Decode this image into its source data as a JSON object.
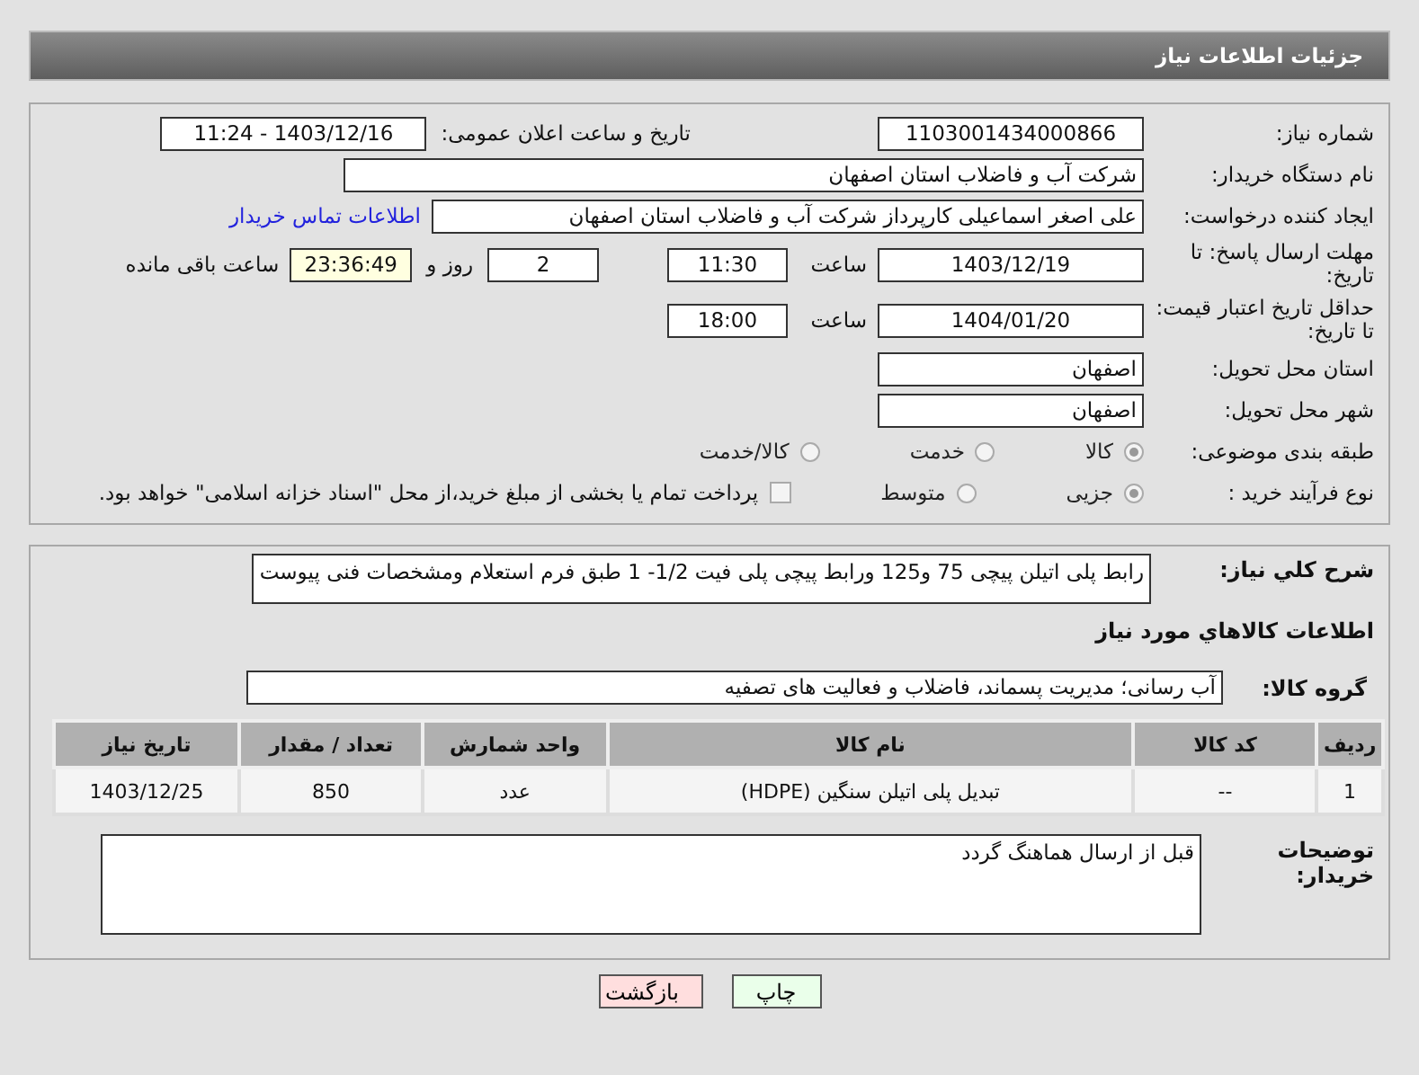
{
  "page_title": "جزئیات اطلاعات نیاز",
  "need_number": {
    "label": "شماره نیاز:",
    "value": "1103001434000866"
  },
  "announce": {
    "label": "تاریخ و ساعت اعلان عمومی:",
    "value": "1403/12/16 - 11:24"
  },
  "buyer_org": {
    "label": "نام دستگاه خریدار:",
    "value": "شرکت آب و فاضلاب استان اصفهان"
  },
  "requester": {
    "label": "ایجاد کننده درخواست:",
    "value": "علی اصغر اسماعیلی کارپرداز شرکت آب و فاضلاب استان اصفهان",
    "link": "اطلاعات تماس خریدار"
  },
  "deadline": {
    "label": "مهلت ارسال پاسخ: تا تاریخ:",
    "date": "1403/12/19",
    "time_label": "ساعت",
    "time": "11:30",
    "days": "2",
    "days_label": "روز و",
    "remaining": "23:36:49",
    "remaining_label": "ساعت باقی مانده"
  },
  "validity": {
    "label": "حداقل تاریخ اعتبار قیمت: تا تاریخ:",
    "date": "1404/01/20",
    "time_label": "ساعت",
    "time": "18:00"
  },
  "province": {
    "label": "استان محل تحویل:",
    "value": "اصفهان"
  },
  "city": {
    "label": "شهر محل تحویل:",
    "value": "اصفهان"
  },
  "category": {
    "label": "طبقه بندی موضوعی:",
    "options": [
      {
        "label": "کالا",
        "selected": true
      },
      {
        "label": "خدمت",
        "selected": false
      },
      {
        "label": "کالا/خدمت",
        "selected": false
      }
    ]
  },
  "process": {
    "label": "نوع فرآیند خرید :",
    "options": [
      {
        "label": "جزیی",
        "selected": true
      },
      {
        "label": "متوسط",
        "selected": false
      }
    ],
    "payment": {
      "checked": false,
      "text": "پرداخت تمام یا بخشی از مبلغ خرید،از محل \"اسناد خزانه اسلامی\" خواهد بود."
    }
  },
  "description": {
    "label": "شرح کلي نياز:",
    "value": "رابط پلی اتیلن پیچی 75 و125 ورابط پیچی پلی فیت 1/2- 1 طبق فرم استعلام ومشخصات فنی پیوست"
  },
  "goods_heading": "اطلاعات کالاهاي مورد نياز",
  "goods_group": {
    "label": "گروه کالا:",
    "value": "آب رسانی؛ مدیریت پسماند، فاضلاب و فعالیت های تصفیه"
  },
  "table": {
    "columns": [
      "ردیف",
      "کد کالا",
      "نام کالا",
      "واحد شمارش",
      "تعداد / مقدار",
      "تاریخ نیاز"
    ],
    "rows": [
      [
        "1",
        "--",
        "تبدیل پلی اتیلن سنگین (HDPE)",
        "عدد",
        "850",
        "1403/12/25"
      ]
    ]
  },
  "buyer_notes": {
    "label": "توضیحات خریدار:",
    "value": "قبل از ارسال هماهنگ گردد"
  },
  "buttons": [
    {
      "label": "چاپ",
      "kind": "print"
    },
    {
      "label": "بازگشت",
      "kind": "back"
    }
  ]
}
